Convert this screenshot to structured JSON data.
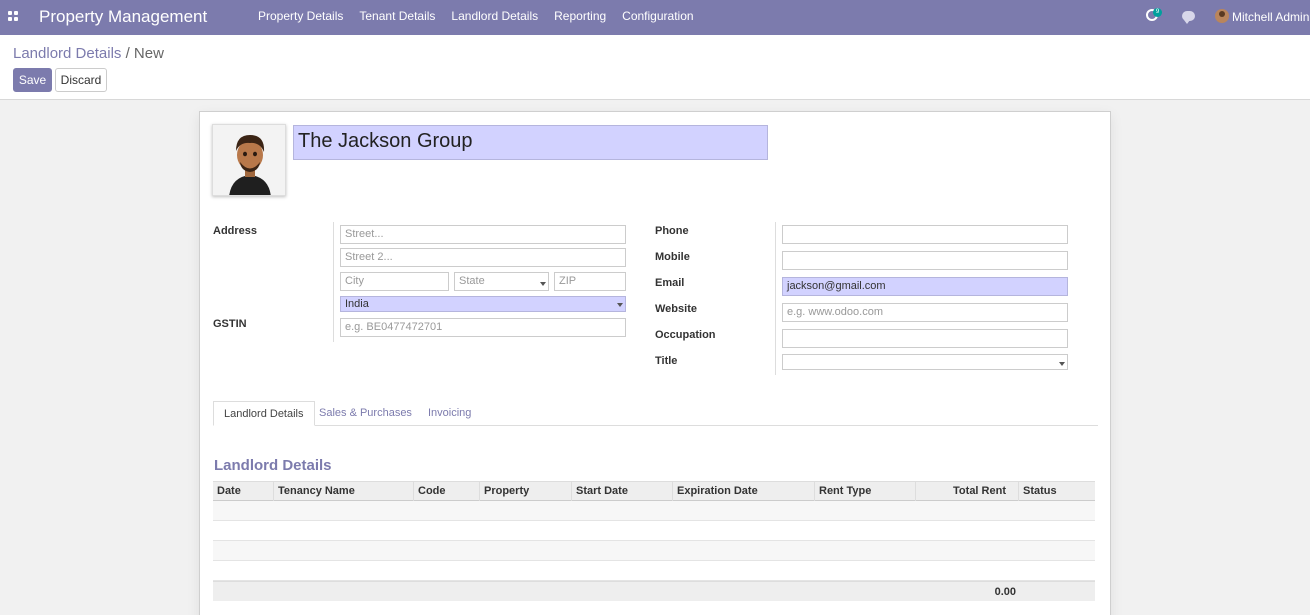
{
  "navbar": {
    "brand": "Property Management",
    "menu": [
      "Property Details",
      "Tenant Details",
      "Landlord Details",
      "Reporting",
      "Configuration"
    ],
    "activity_count": "9",
    "user_name": "Mitchell Admin"
  },
  "breadcrumb": {
    "parent": "Landlord Details",
    "separator": "/",
    "current": "New"
  },
  "buttons": {
    "save": "Save",
    "discard": "Discard"
  },
  "partner": {
    "name": "The Jackson Group"
  },
  "address": {
    "label": "Address",
    "street_placeholder": "Street...",
    "street2_placeholder": "Street 2...",
    "city_placeholder": "City",
    "state_placeholder": "State",
    "zip_placeholder": "ZIP",
    "country": "India"
  },
  "gstin": {
    "label": "GSTIN",
    "placeholder": "e.g. BE0477472701"
  },
  "contact": {
    "phone_label": "Phone",
    "mobile_label": "Mobile",
    "email_label": "Email",
    "email_value": "jackson@gmail.com",
    "website_label": "Website",
    "website_placeholder": "e.g. www.odoo.com",
    "occupation_label": "Occupation",
    "title_label": "Title"
  },
  "tabs": [
    "Landlord Details",
    "Sales & Purchases",
    "Invoicing"
  ],
  "section_title": "Landlord Details",
  "table": {
    "columns": [
      "Date",
      "Tenancy Name",
      "Code",
      "Property",
      "Start Date",
      "Expiration Date",
      "Rent Type",
      "Total Rent",
      "Status"
    ],
    "total_rent": "0.00"
  },
  "colors": {
    "primary": "#7c7bad",
    "highlight": "#d2d2ff",
    "activity_badge": "#00a09d"
  }
}
